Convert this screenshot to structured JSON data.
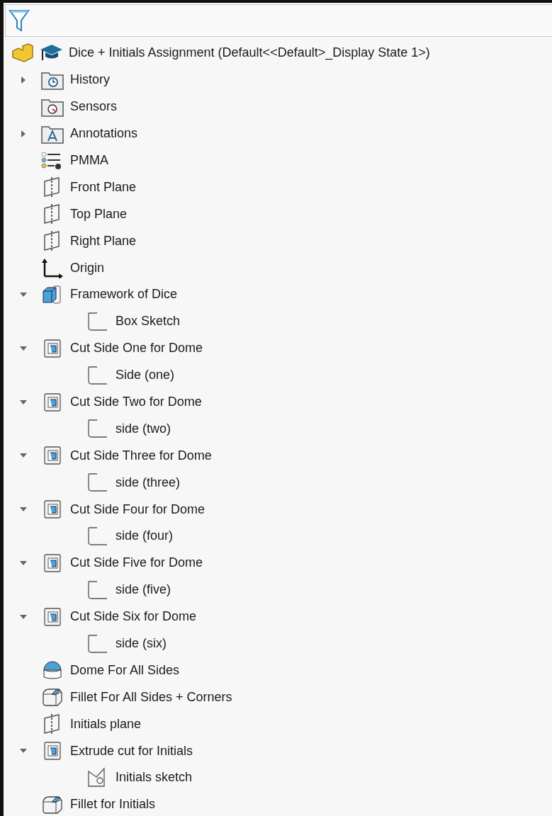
{
  "tree": {
    "root": {
      "label": "Dice + Initials Assignment  (Default<<Default>_Display State 1>)"
    },
    "items": [
      {
        "label": "History",
        "kind": "history",
        "expanded": false
      },
      {
        "label": "Sensors",
        "kind": "sensors"
      },
      {
        "label": "Annotations",
        "kind": "annotations",
        "expanded": false
      },
      {
        "label": "PMMA",
        "kind": "material"
      },
      {
        "label": "Front Plane",
        "kind": "plane"
      },
      {
        "label": "Top Plane",
        "kind": "plane"
      },
      {
        "label": "Right Plane",
        "kind": "plane"
      },
      {
        "label": "Origin",
        "kind": "origin"
      },
      {
        "label": "Framework of Dice",
        "kind": "boss",
        "expanded": true,
        "children": [
          {
            "label": "Box Sketch",
            "kind": "sketch"
          }
        ]
      },
      {
        "label": "Cut Side One for Dome",
        "kind": "cut",
        "expanded": true,
        "children": [
          {
            "label": "Side (one)",
            "kind": "sketch"
          }
        ]
      },
      {
        "label": "Cut Side Two for Dome",
        "kind": "cut",
        "expanded": true,
        "children": [
          {
            "label": "side (two)",
            "kind": "sketch"
          }
        ]
      },
      {
        "label": "Cut Side Three for Dome",
        "kind": "cut",
        "expanded": true,
        "children": [
          {
            "label": "side (three)",
            "kind": "sketch"
          }
        ]
      },
      {
        "label": "Cut Side Four for Dome",
        "kind": "cut",
        "expanded": true,
        "children": [
          {
            "label": "side (four)",
            "kind": "sketch"
          }
        ]
      },
      {
        "label": "Cut Side Five for Dome",
        "kind": "cut",
        "expanded": true,
        "children": [
          {
            "label": "side (five)",
            "kind": "sketch"
          }
        ]
      },
      {
        "label": "Cut Side Six for Dome",
        "kind": "cut",
        "expanded": true,
        "children": [
          {
            "label": "side (six)",
            "kind": "sketch"
          }
        ]
      },
      {
        "label": "Dome For All Sides",
        "kind": "dome"
      },
      {
        "label": "Fillet For All Sides + Corners",
        "kind": "fillet"
      },
      {
        "label": "Initials plane",
        "kind": "plane"
      },
      {
        "label": "Extrude cut for Initials",
        "kind": "cut",
        "expanded": true,
        "children": [
          {
            "label": "Initials sketch",
            "kind": "sketch-circle"
          }
        ]
      },
      {
        "label": "Fillet for Initials",
        "kind": "fillet"
      }
    ]
  }
}
